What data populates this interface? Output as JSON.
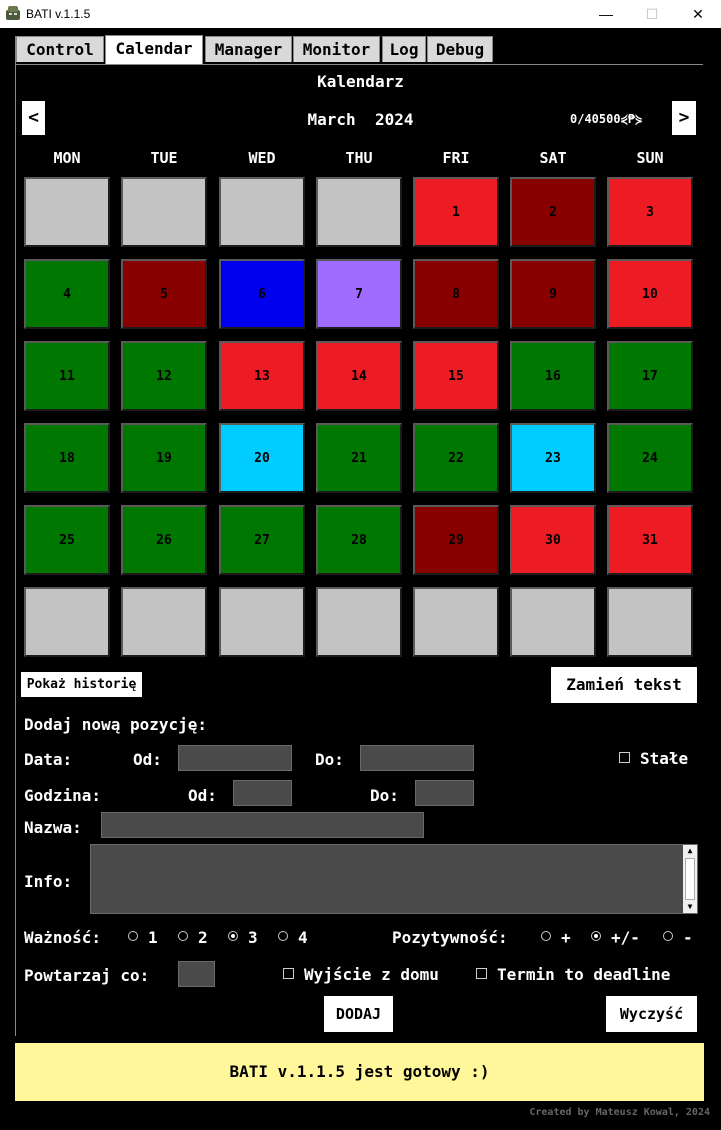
{
  "window": {
    "title": "BATI v.1.1.5",
    "minimize_glyph": "—",
    "maximize_glyph": "☐",
    "close_glyph": "✕"
  },
  "tabs": [
    {
      "label": "Control",
      "active": false
    },
    {
      "label": "Calendar",
      "active": true
    },
    {
      "label": "Manager",
      "active": false
    },
    {
      "label": "Monitor",
      "active": false
    },
    {
      "label": "Log",
      "active": false
    },
    {
      "label": "Debug",
      "active": false
    }
  ],
  "calendar": {
    "heading": "Kalendarz",
    "month_label": "March  2024",
    "prev_glyph": "<",
    "next_glyph": ">",
    "counter": "0/40500⋞₱⋟",
    "day_names": [
      "MON",
      "TUE",
      "WED",
      "THU",
      "FRI",
      "SAT",
      "SUN"
    ],
    "colors": {
      "empty": "#c3c3c3",
      "red": "#ed1c24",
      "darkred": "#880000",
      "green": "#007700",
      "blue": "#0000ee",
      "purple": "#a06bff",
      "cyan": "#00ccff"
    },
    "weeks": [
      [
        {
          "d": "",
          "c": "empty"
        },
        {
          "d": "",
          "c": "empty"
        },
        {
          "d": "",
          "c": "empty"
        },
        {
          "d": "",
          "c": "empty"
        },
        {
          "d": "1",
          "c": "red"
        },
        {
          "d": "2",
          "c": "darkred"
        },
        {
          "d": "3",
          "c": "red"
        }
      ],
      [
        {
          "d": "4",
          "c": "green"
        },
        {
          "d": "5",
          "c": "darkred"
        },
        {
          "d": "6",
          "c": "blue"
        },
        {
          "d": "7",
          "c": "purple"
        },
        {
          "d": "8",
          "c": "darkred"
        },
        {
          "d": "9",
          "c": "darkred"
        },
        {
          "d": "10",
          "c": "red"
        }
      ],
      [
        {
          "d": "11",
          "c": "green"
        },
        {
          "d": "12",
          "c": "green"
        },
        {
          "d": "13",
          "c": "red"
        },
        {
          "d": "14",
          "c": "red"
        },
        {
          "d": "15",
          "c": "red"
        },
        {
          "d": "16",
          "c": "green"
        },
        {
          "d": "17",
          "c": "green"
        }
      ],
      [
        {
          "d": "18",
          "c": "green"
        },
        {
          "d": "19",
          "c": "green"
        },
        {
          "d": "20",
          "c": "cyan"
        },
        {
          "d": "21",
          "c": "green"
        },
        {
          "d": "22",
          "c": "green"
        },
        {
          "d": "23",
          "c": "cyan"
        },
        {
          "d": "24",
          "c": "green"
        }
      ],
      [
        {
          "d": "25",
          "c": "green"
        },
        {
          "d": "26",
          "c": "green"
        },
        {
          "d": "27",
          "c": "green"
        },
        {
          "d": "28",
          "c": "green"
        },
        {
          "d": "29",
          "c": "darkred"
        },
        {
          "d": "30",
          "c": "red"
        },
        {
          "d": "31",
          "c": "red"
        }
      ],
      [
        {
          "d": "",
          "c": "empty"
        },
        {
          "d": "",
          "c": "empty"
        },
        {
          "d": "",
          "c": "empty"
        },
        {
          "d": "",
          "c": "empty"
        },
        {
          "d": "",
          "c": "empty"
        },
        {
          "d": "",
          "c": "empty"
        },
        {
          "d": "",
          "c": "empty"
        }
      ]
    ]
  },
  "buttons": {
    "history": "Pokaż historię",
    "swap_text": "Zamień tekst",
    "add": "DODAJ",
    "clear": "Wyczyść"
  },
  "form": {
    "heading": "Dodaj nową pozycję:",
    "data_label": "Data:",
    "from_label": "Od:",
    "to_label": "Do:",
    "permanent_label": "Stałe",
    "time_label": "Godzina:",
    "name_label": "Nazwa:",
    "info_label": "Info:",
    "importance_label": "Ważność:",
    "importance_options": [
      "1",
      "2",
      "3",
      "4"
    ],
    "importance_selected": "3",
    "positivity_label": "Pozytywność:",
    "positivity_options": [
      "+",
      "+/-",
      "-"
    ],
    "positivity_selected": "+/-",
    "repeat_label": "Powtarzaj co:",
    "leave_home_label": "Wyjście z domu",
    "deadline_label": "Termin to deadline",
    "scroll_up_glyph": "▲",
    "scroll_down_glyph": "▼"
  },
  "status": {
    "text": "BATI v.1.1.5 jest gotowy :)",
    "background": "#fff79a"
  },
  "footer": {
    "credit": "Created by Mateusz Kowal, 2024"
  }
}
